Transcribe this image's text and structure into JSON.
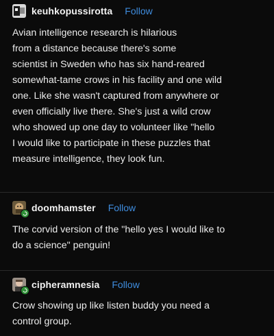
{
  "posts": [
    {
      "username": "keuhkopussirotta",
      "follow_label": "Follow",
      "lines": [
        "Avian intelligence research is hilarious",
        "from a distance because there's some",
        "scientist in Sweden who has six hand-reared",
        "somewhat-tame crows in his facility and one wild",
        "one. Like she wasn't captured from anywhere or",
        "even officially live there. She's just a wild crow",
        "who showed up one day to volunteer like \"hello",
        "I would like to participate in these puzzles that",
        "measure intelligence, they look fun."
      ]
    },
    {
      "username": "doomhamster",
      "follow_label": "Follow",
      "lines": [
        "The corvid version of the \"hello yes I would like to",
        "do a science\" penguin!"
      ]
    },
    {
      "username": "cipheramnesia",
      "follow_label": "Follow",
      "lines": [
        "Crow showing up like listen buddy you need a",
        "control group."
      ]
    }
  ],
  "colors": {
    "background": "#0b0b0b",
    "text": "#f2f2f2",
    "follow_link": "#3f8ddf",
    "divider": "#2a2a2a",
    "badge": "#2e8f36"
  },
  "icons": {
    "avatar_1": "avatar-image",
    "avatar_2": "avatar-image",
    "avatar_3": "avatar-image",
    "badge": "refresh-icon"
  }
}
